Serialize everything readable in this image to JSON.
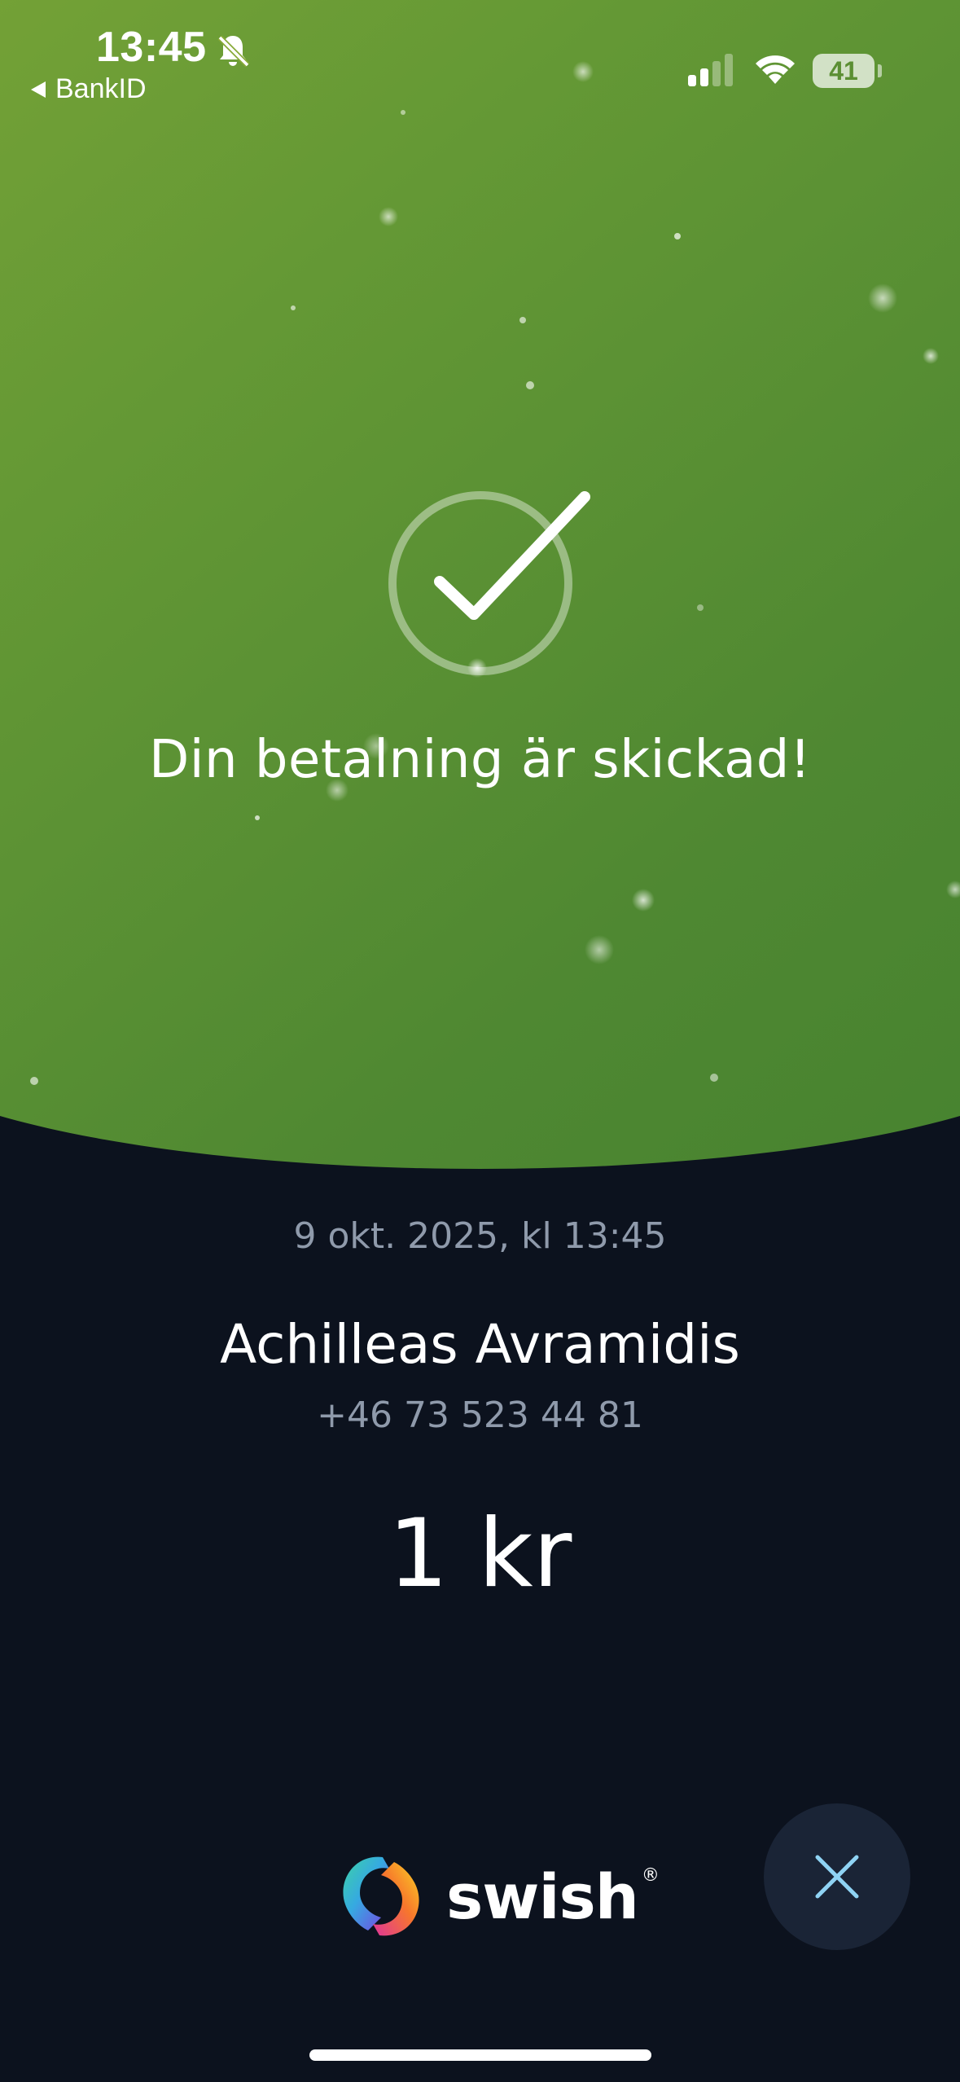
{
  "status_bar": {
    "time": "13:45",
    "back_label": "BankID",
    "battery": "41",
    "icons": [
      "bell-slash-icon",
      "cellular-signal-icon",
      "wifi-icon",
      "battery-icon"
    ]
  },
  "confirmation": {
    "icon": "checkmark-circle-icon",
    "title": "Din betalning är skickad!"
  },
  "payment": {
    "datetime": "9 okt. 2025, kl 13:45",
    "recipient_name": "Achilleas Avramidis",
    "recipient_phone": "+46 73 523 44 81",
    "amount": "1 kr"
  },
  "branding": {
    "logo_text": "swish",
    "registered": "®"
  },
  "close_button": {
    "icon": "close-icon"
  },
  "colors": {
    "hero_gradient_start": "#97b23a",
    "hero_gradient_end": "#46822f",
    "background": "#0c121e",
    "close_button_bg": "#1a2436",
    "close_icon": "#8fd3f4",
    "muted_text": "#8f9aab"
  }
}
